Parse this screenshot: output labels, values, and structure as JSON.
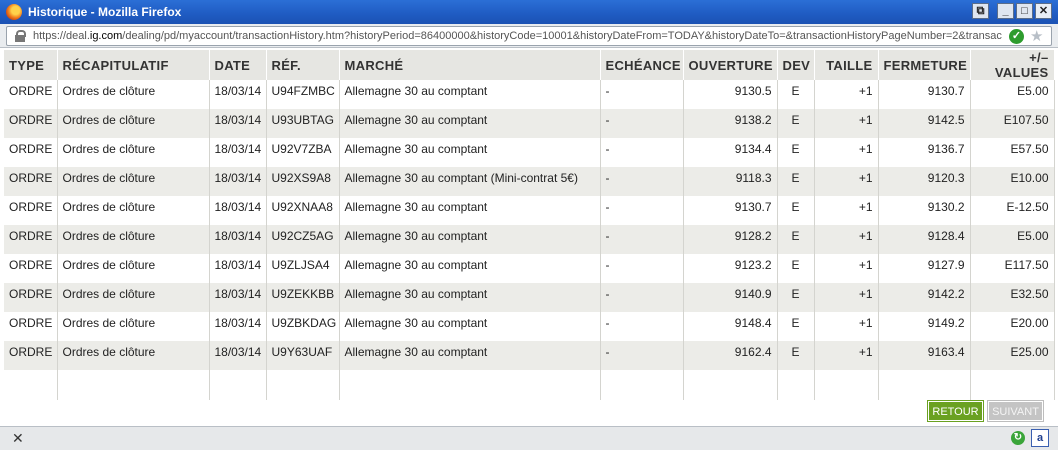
{
  "window": {
    "title": "Historique - Mozilla Firefox",
    "buttons": [
      "⧉",
      "_",
      "□",
      "✕"
    ]
  },
  "urlbar": {
    "url_prefix": "https://deal.",
    "url_domain": "ig.com",
    "url_rest": "/dealing/pd/myaccount/transactionHistory.htm?historyPeriod=86400000&historyCode=10001&historyDateFrom=TODAY&historyDateTo=&transactionHistoryPageNumber=2&transac"
  },
  "table": {
    "headers": [
      "TYPE",
      "RÉCAPITULATIF",
      "DATE",
      "RÉF.",
      "MARCHÉ",
      "ECHÉANCE",
      "OUVERTURE",
      "DEV",
      "TAILLE",
      "FERMETURE",
      "+/– VALUES"
    ],
    "rows": [
      [
        "ORDRE",
        "Ordres de clôture",
        "18/03/14",
        "U94FZMBC",
        "Allemagne 30 au comptant",
        "-",
        "9130.5",
        "E",
        "+1",
        "9130.7",
        "E5.00"
      ],
      [
        "ORDRE",
        "Ordres de clôture",
        "18/03/14",
        "U93UBTAG",
        "Allemagne 30 au comptant",
        "-",
        "9138.2",
        "E",
        "+1",
        "9142.5",
        "E107.50"
      ],
      [
        "ORDRE",
        "Ordres de clôture",
        "18/03/14",
        "U92V7ZBA",
        "Allemagne 30 au comptant",
        "-",
        "9134.4",
        "E",
        "+1",
        "9136.7",
        "E57.50"
      ],
      [
        "ORDRE",
        "Ordres de clôture",
        "18/03/14",
        "U92XS9A8",
        "Allemagne 30 au comptant (Mini-contrat 5€)",
        "-",
        "9118.3",
        "E",
        "+1",
        "9120.3",
        "E10.00"
      ],
      [
        "ORDRE",
        "Ordres de clôture",
        "18/03/14",
        "U92XNAA8",
        "Allemagne 30 au comptant",
        "-",
        "9130.7",
        "E",
        "+1",
        "9130.2",
        "E-12.50"
      ],
      [
        "ORDRE",
        "Ordres de clôture",
        "18/03/14",
        "U92CZ5AG",
        "Allemagne 30 au comptant",
        "-",
        "9128.2",
        "E",
        "+1",
        "9128.4",
        "E5.00"
      ],
      [
        "ORDRE",
        "Ordres de clôture",
        "18/03/14",
        "U9ZLJSA4",
        "Allemagne 30 au comptant",
        "-",
        "9123.2",
        "E",
        "+1",
        "9127.9",
        "E117.50"
      ],
      [
        "ORDRE",
        "Ordres de clôture",
        "18/03/14",
        "U9ZEKKBB",
        "Allemagne 30 au comptant",
        "-",
        "9140.9",
        "E",
        "+1",
        "9142.2",
        "E32.50"
      ],
      [
        "ORDRE",
        "Ordres de clôture",
        "18/03/14",
        "U9ZBKDAG",
        "Allemagne 30 au comptant",
        "-",
        "9148.4",
        "E",
        "+1",
        "9149.2",
        "E20.00"
      ],
      [
        "ORDRE",
        "Ordres de clôture",
        "18/03/14",
        "U9Y63UAF",
        "Allemagne 30 au comptant",
        "-",
        "9162.4",
        "E",
        "+1",
        "9163.4",
        "E25.00"
      ]
    ]
  },
  "buttons": {
    "retour": "RETOUR",
    "suivant": "SUIVANT"
  },
  "statusbar": {
    "close": "✕",
    "addon": "a"
  },
  "colors": {
    "titlebar": "#1f5bc2",
    "retour_button": "#6aa121",
    "suivant_button": "#c4c4c4",
    "header_bg": "#e6e6e2",
    "row_alt_bg": "#ecece8"
  }
}
